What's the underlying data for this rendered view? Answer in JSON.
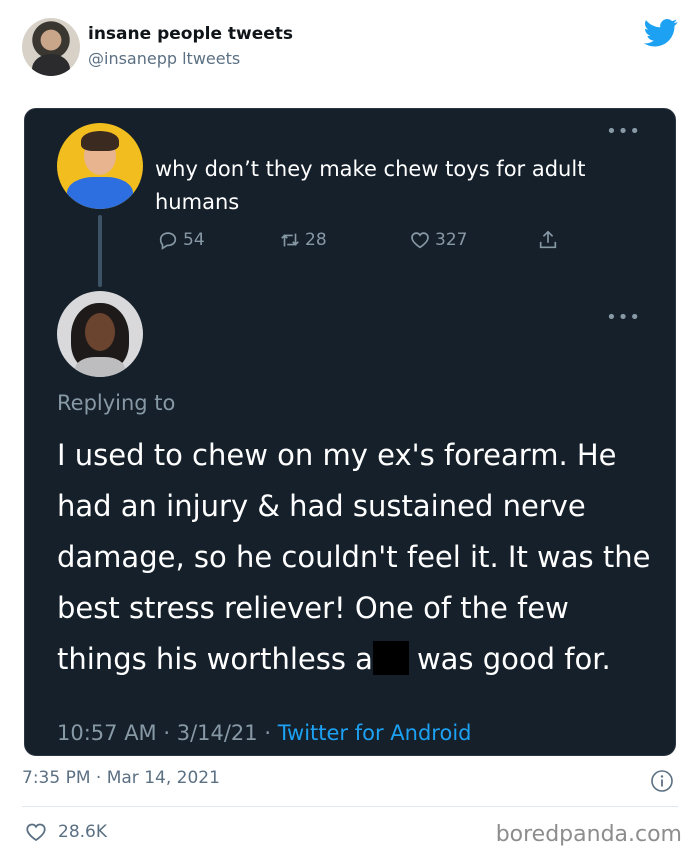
{
  "account": {
    "name": "insane people tweets",
    "handle": "@insanepp ltweets"
  },
  "embedded": {
    "original_tweet": {
      "text": "why don’t they make chew toys for adult humans",
      "replies": "54",
      "retweets": "28",
      "likes": "327"
    },
    "reply_tweet": {
      "replying_to": "Replying to",
      "text_before_censor": "I used to chew on my ex's forearm. He had an injury & had sustained nerve damage, so he couldn't feel it. It was the best stress reliever! One of the few things his worthless a",
      "text_after_censor": "was good for.",
      "time_date": "10:57 AM · 3/14/21 · ",
      "source": "Twitter for Android"
    }
  },
  "footer": {
    "timestamp": "7:35 PM · Mar 14, 2021",
    "likes": "28.6K",
    "watermark": "boredpanda.com"
  },
  "colors": {
    "card_bg": "#15202b",
    "accent": "#1da1f2",
    "muted": "#8899a6"
  }
}
